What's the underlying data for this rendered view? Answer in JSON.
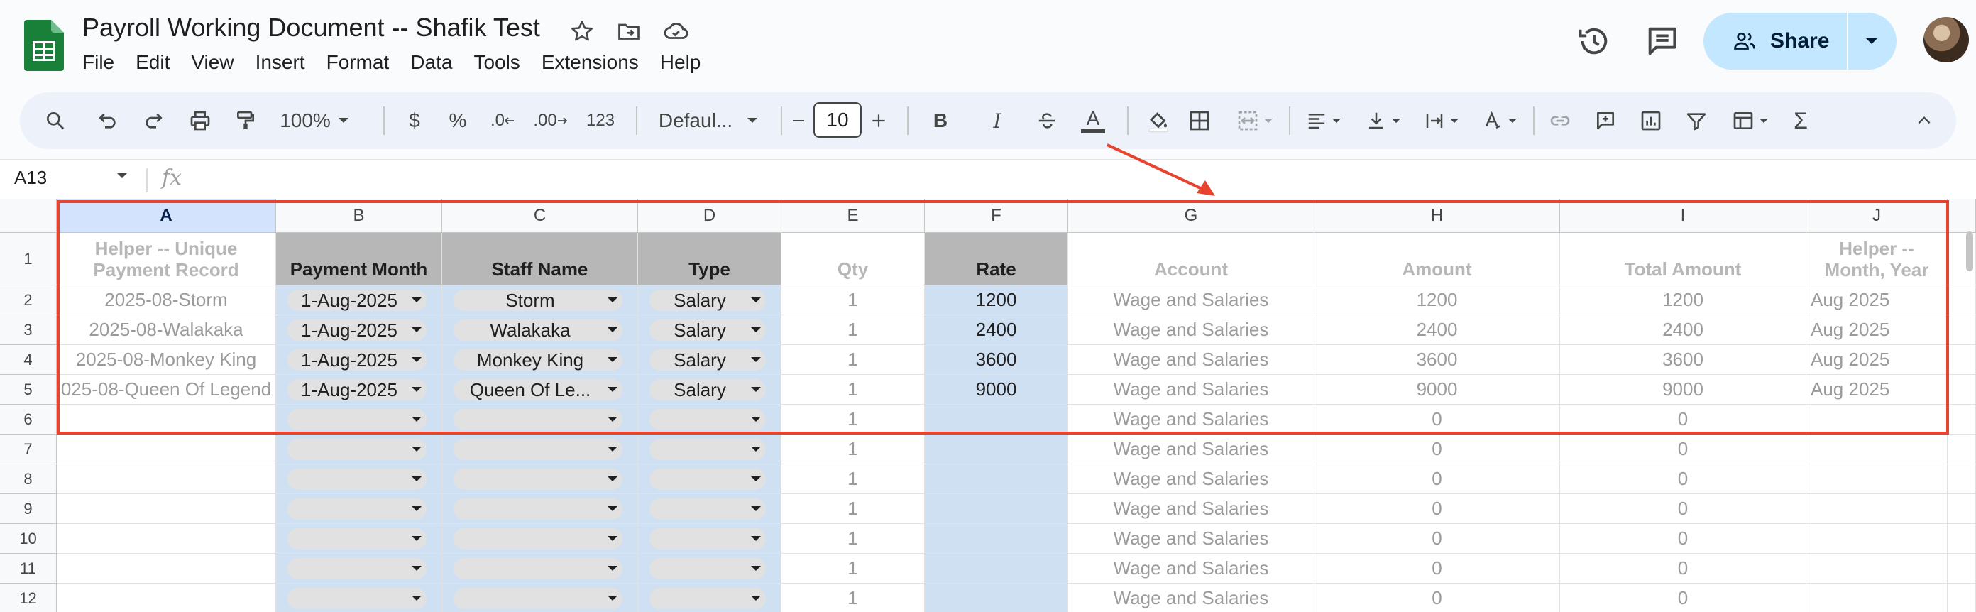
{
  "document": {
    "title": "Payroll Working Document -- Shafik Test",
    "menu": [
      "File",
      "Edit",
      "View",
      "Insert",
      "Format",
      "Data",
      "Tools",
      "Extensions",
      "Help"
    ],
    "share_label": "Share"
  },
  "toolbar": {
    "zoom": "100%",
    "currency": "$",
    "percent": "%",
    "dec_decrease": ".0",
    "dec_increase": ".00",
    "more_formats": "123",
    "font": "Defaul...",
    "font_size": "10",
    "bold": "B",
    "italic": "I",
    "text_color": "A",
    "function": "Σ"
  },
  "formula_bar": {
    "cell_ref": "A13",
    "fx": "fx"
  },
  "grid": {
    "columns": [
      "A",
      "B",
      "C",
      "D",
      "E",
      "F",
      "G",
      "H",
      "I",
      "J"
    ],
    "selected_column": "A",
    "row_numbers": [
      "1",
      "2",
      "3",
      "4",
      "5",
      "6",
      "7",
      "8",
      "9",
      "10",
      "11",
      "12"
    ],
    "headers": {
      "a": "Helper -- Unique Payment Record",
      "b": "Payment Month",
      "c": "Staff Name",
      "d": "Type",
      "e": "Qty",
      "f": "Rate",
      "g": "Account",
      "h": "Amount",
      "i": "Total Amount",
      "j": "Helper -- Month, Year"
    },
    "rows": [
      {
        "a": "2025-08-Storm",
        "b": "1-Aug-2025",
        "c": "Storm",
        "d": "Salary",
        "e": "1",
        "f": "1200",
        "g": "Wage and Salaries",
        "h": "1200",
        "i": "1200",
        "j": "Aug 2025"
      },
      {
        "a": "2025-08-Walakaka",
        "b": "1-Aug-2025",
        "c": "Walakaka",
        "d": "Salary",
        "e": "1",
        "f": "2400",
        "g": "Wage and Salaries",
        "h": "2400",
        "i": "2400",
        "j": "Aug 2025"
      },
      {
        "a": "2025-08-Monkey King",
        "b": "1-Aug-2025",
        "c": "Monkey King",
        "d": "Salary",
        "e": "1",
        "f": "3600",
        "g": "Wage and Salaries",
        "h": "3600",
        "i": "3600",
        "j": "Aug 2025"
      },
      {
        "a": "025-08-Queen Of Legend",
        "b": "1-Aug-2025",
        "c": "Queen Of Le...",
        "d": "Salary",
        "e": "1",
        "f": "9000",
        "g": "Wage and Salaries",
        "h": "9000",
        "i": "9000",
        "j": "Aug 2025"
      },
      {
        "a": "",
        "b": "",
        "c": "",
        "d": "",
        "e": "1",
        "f": "",
        "g": "Wage and Salaries",
        "h": "0",
        "i": "0",
        "j": ""
      },
      {
        "a": "",
        "b": "",
        "c": "",
        "d": "",
        "e": "1",
        "f": "",
        "g": "Wage and Salaries",
        "h": "0",
        "i": "0",
        "j": ""
      },
      {
        "a": "",
        "b": "",
        "c": "",
        "d": "",
        "e": "1",
        "f": "",
        "g": "Wage and Salaries",
        "h": "0",
        "i": "0",
        "j": ""
      },
      {
        "a": "",
        "b": "",
        "c": "",
        "d": "",
        "e": "1",
        "f": "",
        "g": "Wage and Salaries",
        "h": "0",
        "i": "0",
        "j": ""
      },
      {
        "a": "",
        "b": "",
        "c": "",
        "d": "",
        "e": "1",
        "f": "",
        "g": "Wage and Salaries",
        "h": "0",
        "i": "0",
        "j": ""
      },
      {
        "a": "",
        "b": "",
        "c": "",
        "d": "",
        "e": "1",
        "f": "",
        "g": "Wage and Salaries",
        "h": "0",
        "i": "0",
        "j": ""
      },
      {
        "a": "",
        "b": "",
        "c": "",
        "d": "",
        "e": "1",
        "f": "",
        "g": "Wage and Salaries",
        "h": "0",
        "i": "0",
        "j": ""
      }
    ]
  },
  "colors": {
    "annotation": "#e8432e",
    "input_column": "#cfe0f3",
    "header_dark": "#b7b7b7",
    "share_button": "#c2e7ff"
  }
}
